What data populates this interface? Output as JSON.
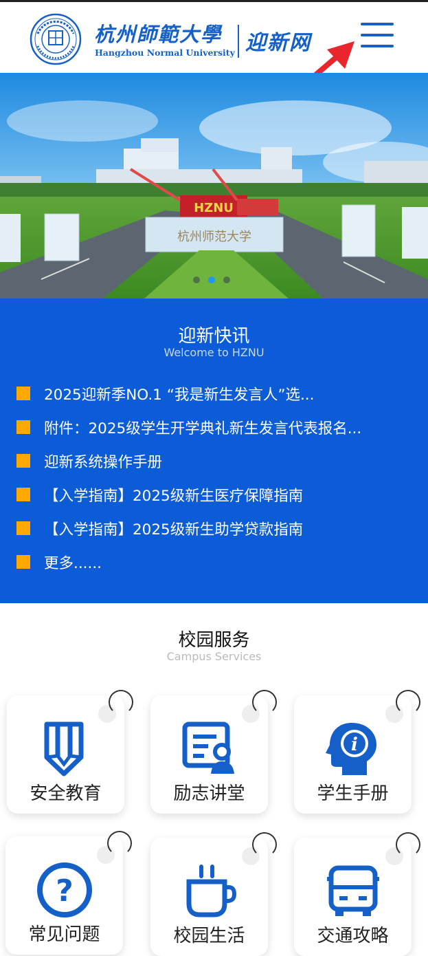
{
  "header": {
    "school_name_cn": "杭州師範大學",
    "school_name_en": "Hangzhou Normal University",
    "site_name": "迎新网",
    "seal_text": "杭州师范大学",
    "menu_icon": "hamburger-menu-icon",
    "annotation_arrow_color": "#e8262b"
  },
  "banner": {
    "gate_sign": "HZNU",
    "stone_text": "杭州师范大学",
    "slides": 3,
    "active_slide": 2
  },
  "news": {
    "title": "迎新快讯",
    "subtitle": "Welcome to HZNU",
    "items": [
      "2025迎新季NO.1 “我是新生发言人”选...",
      "附件：2025级学生开学典礼新生发言代表报名...",
      "迎新系统操作手册",
      "【入学指南】2025级新生医疗保障指南",
      "【入学指南】2025级新生助学贷款指南",
      "更多......"
    ]
  },
  "services": {
    "title": "校园服务",
    "subtitle": "Campus Services",
    "cards": [
      {
        "label": "安全教育",
        "icon": "pencil-shield-icon"
      },
      {
        "label": "励志讲堂",
        "icon": "lecture-document-icon"
      },
      {
        "label": "学生手册",
        "icon": "info-head-icon"
      },
      {
        "label": "常见问题",
        "icon": "question-icon"
      },
      {
        "label": "校园生活",
        "icon": "coffee-cup-icon"
      },
      {
        "label": "交通攻略",
        "icon": "bus-icon"
      }
    ]
  },
  "colors": {
    "primary": "#0b5cd6",
    "brand": "#1560c8",
    "bullet": "#ffa800",
    "active_dot": "#2196f3"
  }
}
